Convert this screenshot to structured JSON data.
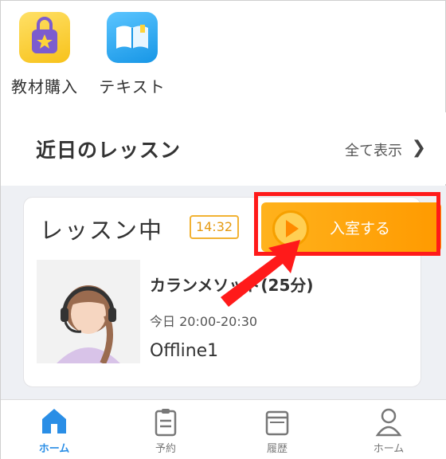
{
  "shortcuts": [
    {
      "label": "教材購入",
      "icon": "shopping-bag-icon"
    },
    {
      "label": "テキスト",
      "icon": "book-icon"
    }
  ],
  "section": {
    "title": "近日のレッスン",
    "show_all": "全て表示"
  },
  "lesson": {
    "status": "レッスン中",
    "timer": "14:32",
    "enter_label": "入室する",
    "name": "カランメソッド(25分)",
    "time": "今日 20:00-20:30",
    "room": "Offline1"
  },
  "tabs": [
    {
      "label": "ホーム",
      "icon": "home-icon",
      "active": true
    },
    {
      "label": "予約",
      "icon": "clipboard-icon"
    },
    {
      "label": "履歴",
      "icon": "book-stack-icon"
    },
    {
      "label": "ホーム",
      "icon": "person-icon"
    }
  ],
  "colors": {
    "accent": "#ff9a00",
    "highlight": "#ff1a1a",
    "tab_active": "#2a8ee6"
  }
}
